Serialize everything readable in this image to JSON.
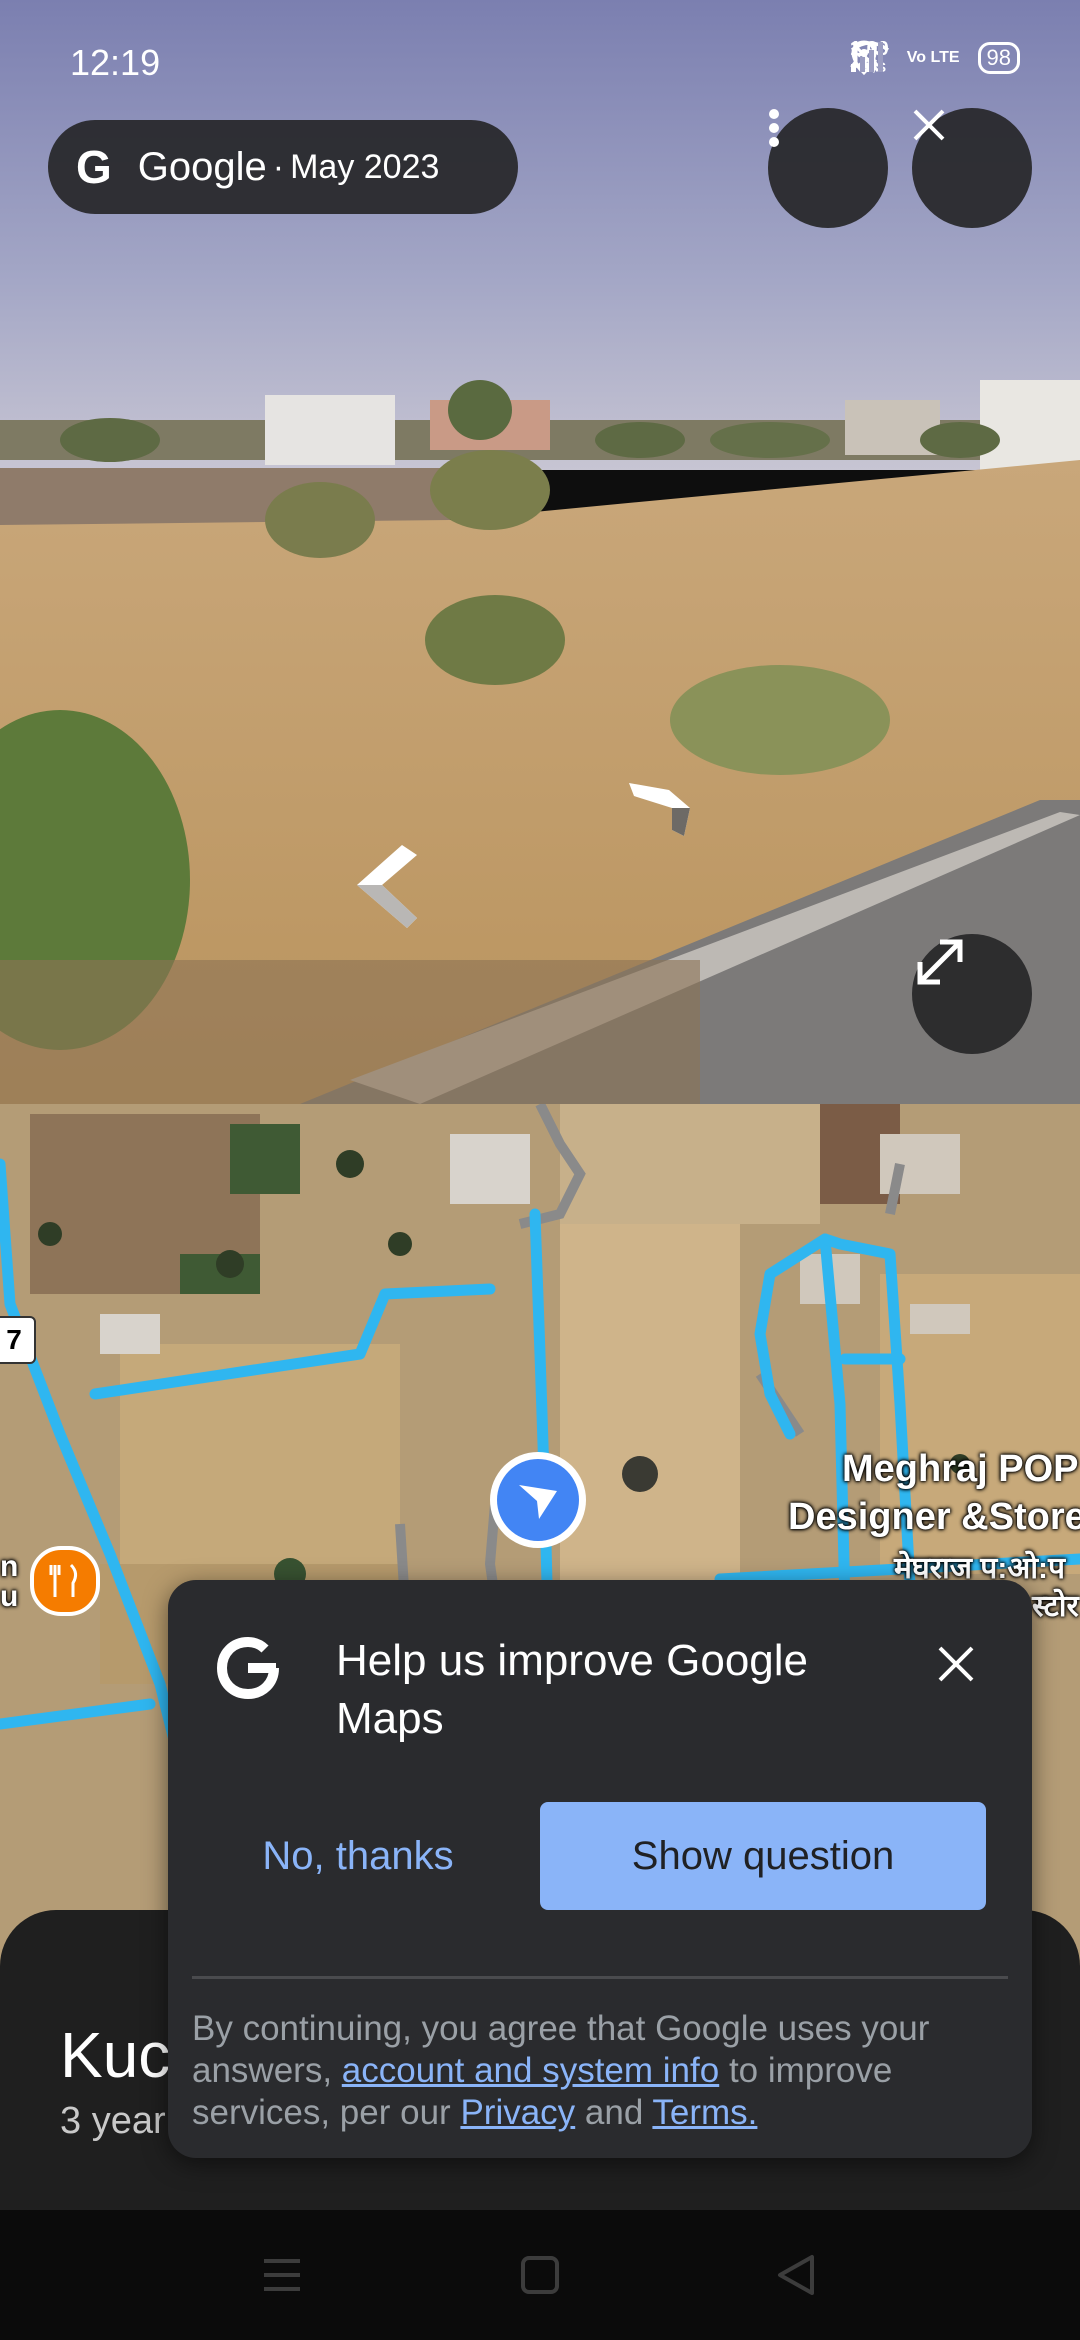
{
  "status_bar": {
    "time": "12:19",
    "net_speed_value": "1.00",
    "net_speed_unit": "KB/S",
    "volte": "Vo LTE",
    "battery": "98",
    "icons": [
      "mute-bell-icon",
      "location-icon",
      "wifi-icon",
      "signal-icon"
    ]
  },
  "street_view": {
    "brand_letter": "G",
    "brand": "Google",
    "separator": "·",
    "date": "May 2023",
    "more_icon": "vertical-dots-icon",
    "close_icon": "close-icon",
    "expand_icon": "expand-icon"
  },
  "map": {
    "place_label_line1": "Meghraj POP",
    "place_label_line2": "Designer &Store",
    "place_label_hindi_line1": "मेघराज प:ओ:प",
    "place_label_hindi_line2": "स्टोर",
    "route_number": "7",
    "left_edge_letter_1": "n",
    "left_edge_letter_2": "u"
  },
  "bottom_sheet": {
    "title": "Kuc",
    "subtitle": "3 year"
  },
  "dialog": {
    "logo_letter": "G",
    "title": "Help us improve Google Maps",
    "no_thanks": "No, thanks",
    "show_question": "Show question",
    "legal_part1": "By continuing, you agree that Google uses your answers, ",
    "legal_link1": "account and system info",
    "legal_part2": " to improve services, per our ",
    "legal_link2": "Privacy",
    "legal_part3": " and ",
    "legal_link3": "Terms."
  },
  "colors": {
    "accent_blue": "#8ab4f8",
    "route_blue": "#2fb6f0",
    "dialog_bg": "#2a2b2e",
    "food_pin": "#f57c00",
    "location_blue": "#4285f4"
  }
}
